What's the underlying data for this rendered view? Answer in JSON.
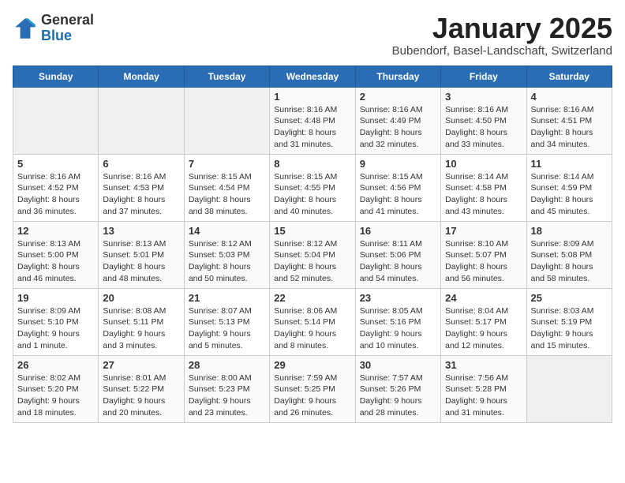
{
  "header": {
    "logo_general": "General",
    "logo_blue": "Blue",
    "month_title": "January 2025",
    "subtitle": "Bubendorf, Basel-Landschaft, Switzerland"
  },
  "days_of_week": [
    "Sunday",
    "Monday",
    "Tuesday",
    "Wednesday",
    "Thursday",
    "Friday",
    "Saturday"
  ],
  "weeks": [
    [
      {
        "day": "",
        "info": ""
      },
      {
        "day": "",
        "info": ""
      },
      {
        "day": "",
        "info": ""
      },
      {
        "day": "1",
        "info": "Sunrise: 8:16 AM\nSunset: 4:48 PM\nDaylight: 8 hours and 31 minutes."
      },
      {
        "day": "2",
        "info": "Sunrise: 8:16 AM\nSunset: 4:49 PM\nDaylight: 8 hours and 32 minutes."
      },
      {
        "day": "3",
        "info": "Sunrise: 8:16 AM\nSunset: 4:50 PM\nDaylight: 8 hours and 33 minutes."
      },
      {
        "day": "4",
        "info": "Sunrise: 8:16 AM\nSunset: 4:51 PM\nDaylight: 8 hours and 34 minutes."
      }
    ],
    [
      {
        "day": "5",
        "info": "Sunrise: 8:16 AM\nSunset: 4:52 PM\nDaylight: 8 hours and 36 minutes."
      },
      {
        "day": "6",
        "info": "Sunrise: 8:16 AM\nSunset: 4:53 PM\nDaylight: 8 hours and 37 minutes."
      },
      {
        "day": "7",
        "info": "Sunrise: 8:15 AM\nSunset: 4:54 PM\nDaylight: 8 hours and 38 minutes."
      },
      {
        "day": "8",
        "info": "Sunrise: 8:15 AM\nSunset: 4:55 PM\nDaylight: 8 hours and 40 minutes."
      },
      {
        "day": "9",
        "info": "Sunrise: 8:15 AM\nSunset: 4:56 PM\nDaylight: 8 hours and 41 minutes."
      },
      {
        "day": "10",
        "info": "Sunrise: 8:14 AM\nSunset: 4:58 PM\nDaylight: 8 hours and 43 minutes."
      },
      {
        "day": "11",
        "info": "Sunrise: 8:14 AM\nSunset: 4:59 PM\nDaylight: 8 hours and 45 minutes."
      }
    ],
    [
      {
        "day": "12",
        "info": "Sunrise: 8:13 AM\nSunset: 5:00 PM\nDaylight: 8 hours and 46 minutes."
      },
      {
        "day": "13",
        "info": "Sunrise: 8:13 AM\nSunset: 5:01 PM\nDaylight: 8 hours and 48 minutes."
      },
      {
        "day": "14",
        "info": "Sunrise: 8:12 AM\nSunset: 5:03 PM\nDaylight: 8 hours and 50 minutes."
      },
      {
        "day": "15",
        "info": "Sunrise: 8:12 AM\nSunset: 5:04 PM\nDaylight: 8 hours and 52 minutes."
      },
      {
        "day": "16",
        "info": "Sunrise: 8:11 AM\nSunset: 5:06 PM\nDaylight: 8 hours and 54 minutes."
      },
      {
        "day": "17",
        "info": "Sunrise: 8:10 AM\nSunset: 5:07 PM\nDaylight: 8 hours and 56 minutes."
      },
      {
        "day": "18",
        "info": "Sunrise: 8:09 AM\nSunset: 5:08 PM\nDaylight: 8 hours and 58 minutes."
      }
    ],
    [
      {
        "day": "19",
        "info": "Sunrise: 8:09 AM\nSunset: 5:10 PM\nDaylight: 9 hours and 1 minute."
      },
      {
        "day": "20",
        "info": "Sunrise: 8:08 AM\nSunset: 5:11 PM\nDaylight: 9 hours and 3 minutes."
      },
      {
        "day": "21",
        "info": "Sunrise: 8:07 AM\nSunset: 5:13 PM\nDaylight: 9 hours and 5 minutes."
      },
      {
        "day": "22",
        "info": "Sunrise: 8:06 AM\nSunset: 5:14 PM\nDaylight: 9 hours and 8 minutes."
      },
      {
        "day": "23",
        "info": "Sunrise: 8:05 AM\nSunset: 5:16 PM\nDaylight: 9 hours and 10 minutes."
      },
      {
        "day": "24",
        "info": "Sunrise: 8:04 AM\nSunset: 5:17 PM\nDaylight: 9 hours and 12 minutes."
      },
      {
        "day": "25",
        "info": "Sunrise: 8:03 AM\nSunset: 5:19 PM\nDaylight: 9 hours and 15 minutes."
      }
    ],
    [
      {
        "day": "26",
        "info": "Sunrise: 8:02 AM\nSunset: 5:20 PM\nDaylight: 9 hours and 18 minutes."
      },
      {
        "day": "27",
        "info": "Sunrise: 8:01 AM\nSunset: 5:22 PM\nDaylight: 9 hours and 20 minutes."
      },
      {
        "day": "28",
        "info": "Sunrise: 8:00 AM\nSunset: 5:23 PM\nDaylight: 9 hours and 23 minutes."
      },
      {
        "day": "29",
        "info": "Sunrise: 7:59 AM\nSunset: 5:25 PM\nDaylight: 9 hours and 26 minutes."
      },
      {
        "day": "30",
        "info": "Sunrise: 7:57 AM\nSunset: 5:26 PM\nDaylight: 9 hours and 28 minutes."
      },
      {
        "day": "31",
        "info": "Sunrise: 7:56 AM\nSunset: 5:28 PM\nDaylight: 9 hours and 31 minutes."
      },
      {
        "day": "",
        "info": ""
      }
    ]
  ]
}
